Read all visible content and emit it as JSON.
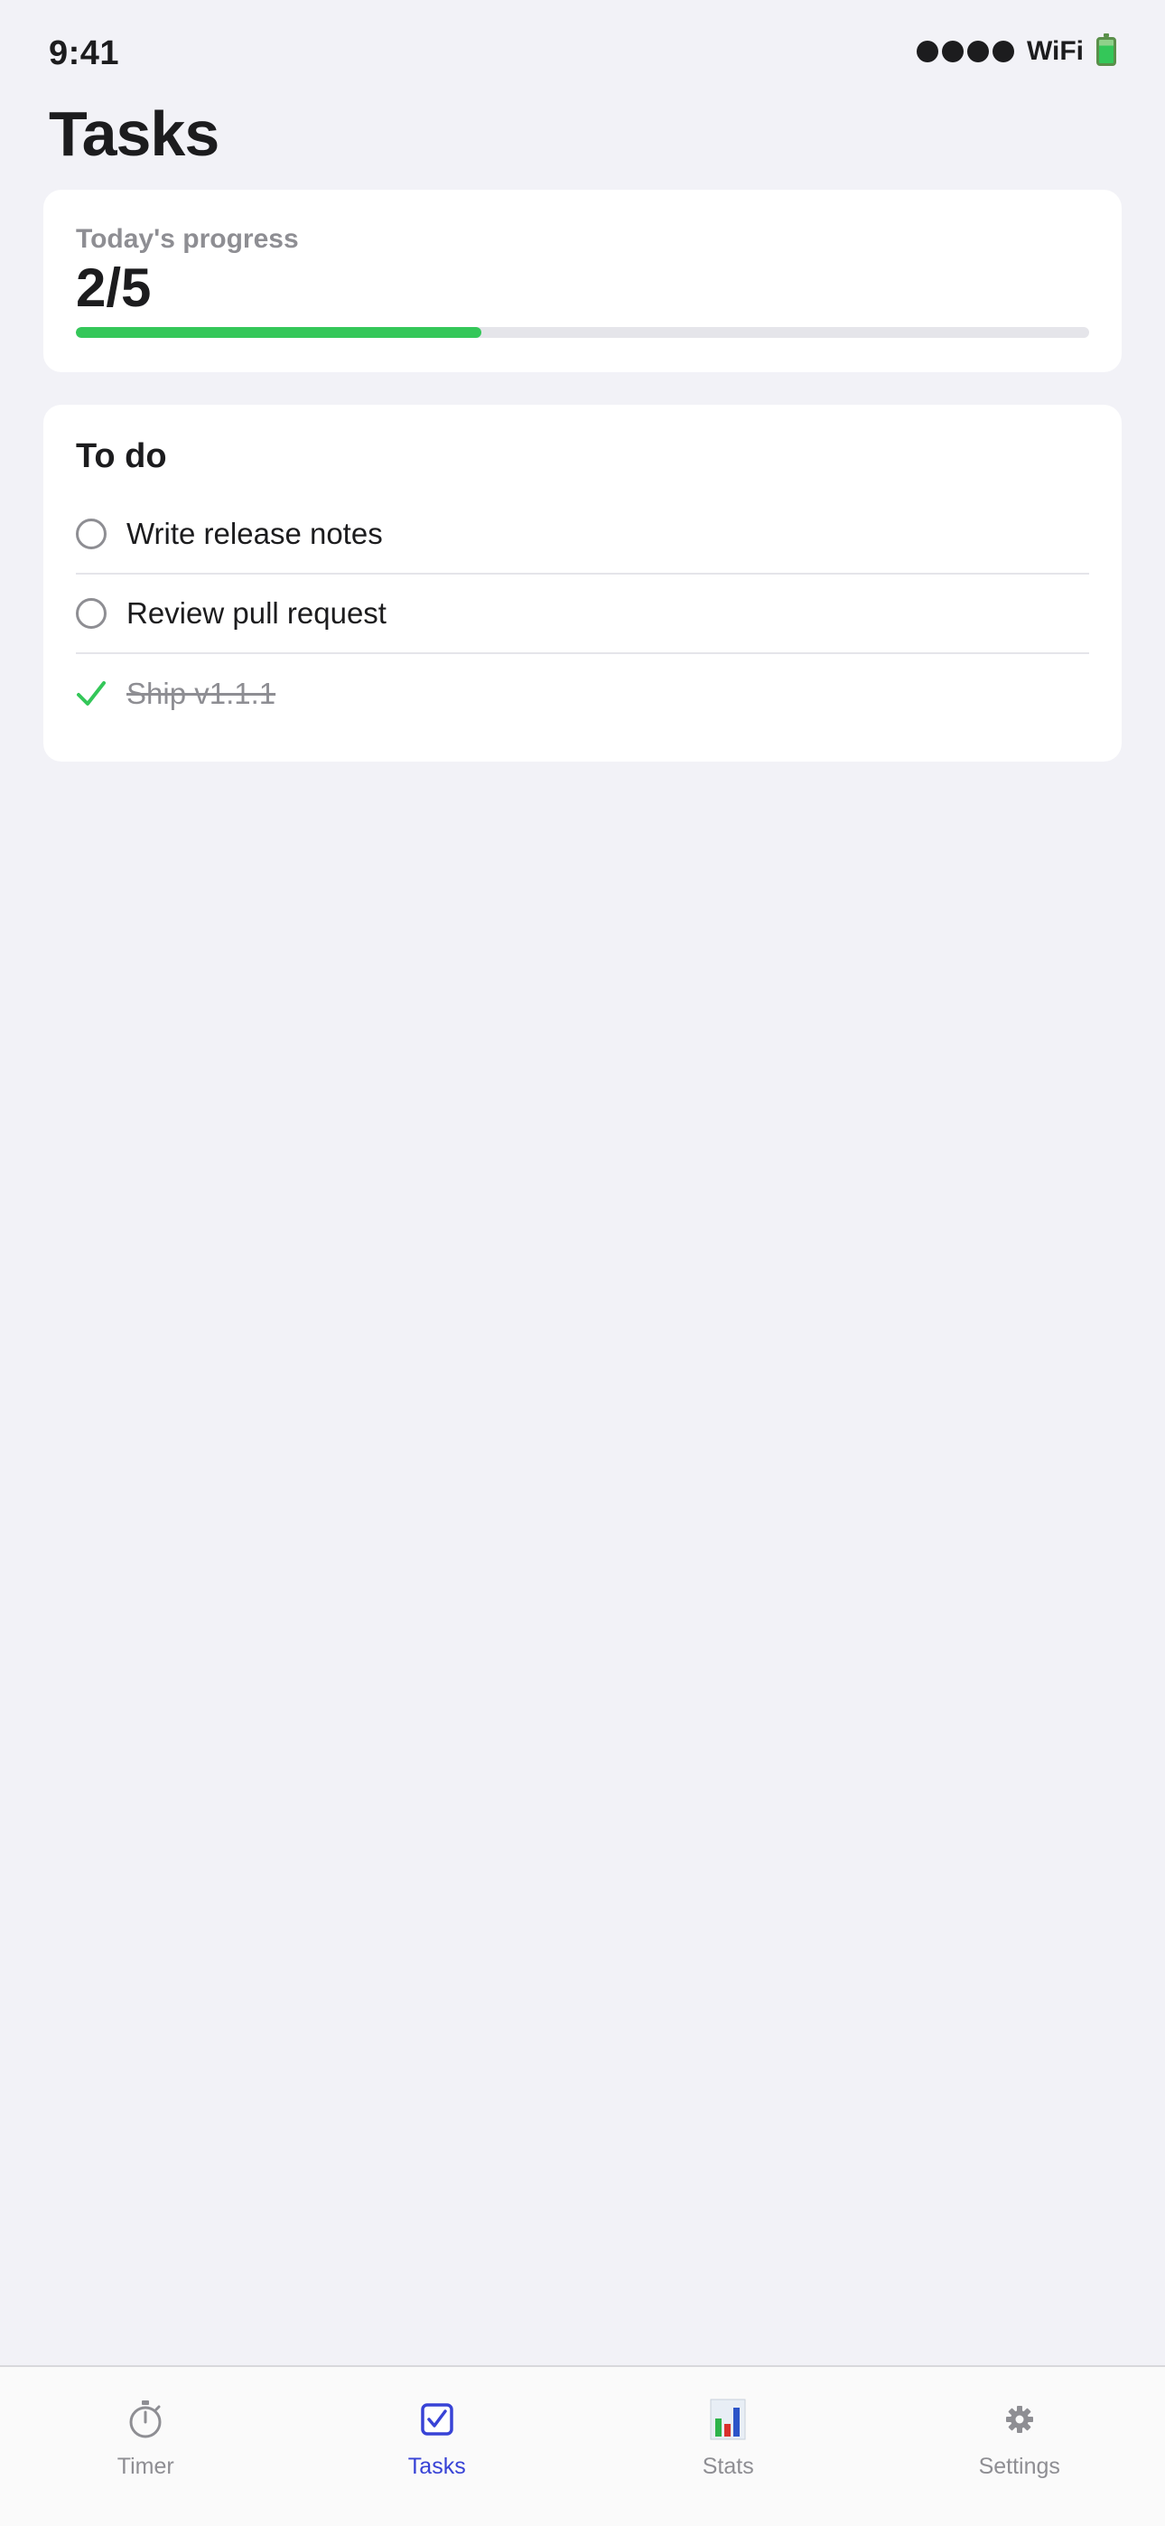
{
  "status_bar": {
    "time": "9:41",
    "wifi": "WiFi"
  },
  "header": {
    "title": "Tasks"
  },
  "progress": {
    "label": "Today's progress",
    "value_text": "2/5",
    "completed": 2,
    "total": 5
  },
  "todo": {
    "heading": "To do",
    "tasks": [
      {
        "label": "Write release notes",
        "done": false
      },
      {
        "label": "Review pull request",
        "done": false
      },
      {
        "label": "Ship v1.1.1",
        "done": true
      }
    ]
  },
  "tab_bar": {
    "active": "Tasks",
    "items": [
      {
        "label": "Timer",
        "icon": "stopwatch-icon"
      },
      {
        "label": "Tasks",
        "icon": "checkbox-icon"
      },
      {
        "label": "Stats",
        "icon": "bar-chart-icon"
      },
      {
        "label": "Settings",
        "icon": "gear-icon"
      }
    ]
  },
  "colors": {
    "accent": "#3843d6",
    "progress_fill": "#34c759",
    "background": "#f2f2f7"
  }
}
